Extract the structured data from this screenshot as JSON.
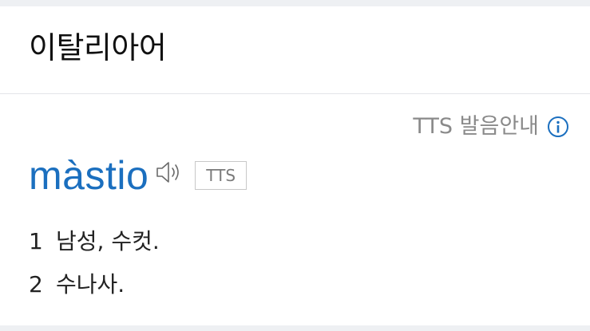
{
  "header": {
    "title": "이탈리아어"
  },
  "entry": {
    "tts_guide_label": "TTS 발음안내",
    "headword": "màstio",
    "tts_badge": "TTS",
    "definitions": [
      {
        "num": "1",
        "text": "남성, 수컷."
      },
      {
        "num": "2",
        "text": "수나사."
      }
    ]
  },
  "colors": {
    "headword": "#1b6fbf",
    "info_icon": "#1b6fbf",
    "muted_text": "#8a8a8a"
  },
  "icons": {
    "info": "info-circle-icon",
    "speaker": "speaker-icon"
  }
}
